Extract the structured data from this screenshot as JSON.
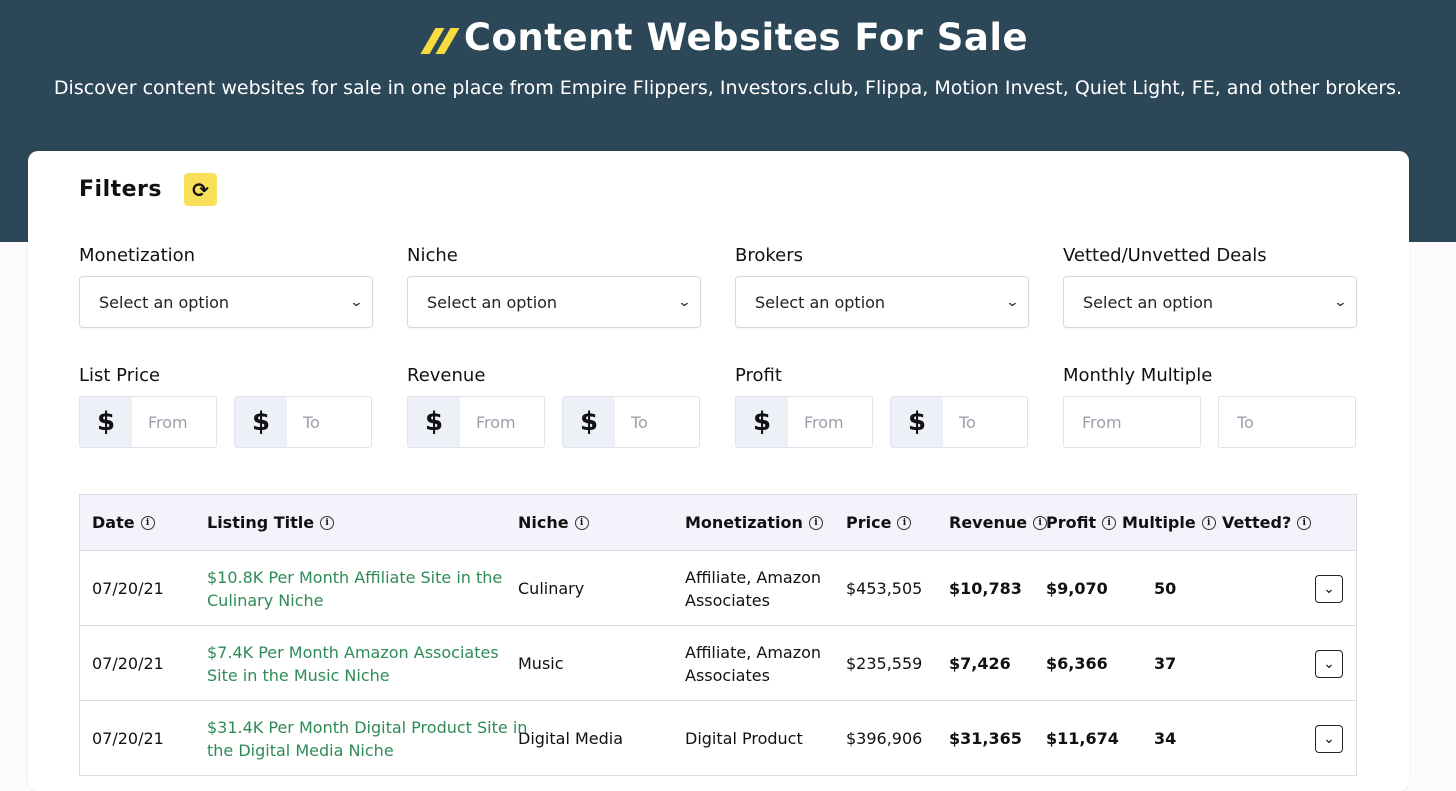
{
  "header": {
    "title": "Content Websites For Sale",
    "subtitle": "Discover content websites for sale in one place from Empire Flippers, Investors.club, Flippa, Motion Invest, Quiet Light, FE, and other brokers."
  },
  "filters": {
    "title": "Filters",
    "reset_icon": "refresh-icon",
    "selects": [
      {
        "label": "Monetization",
        "value": "Select an option"
      },
      {
        "label": "Niche",
        "value": "Select an option"
      },
      {
        "label": "Brokers",
        "value": "Select an option"
      },
      {
        "label": "Vetted/Unvetted Deals",
        "value": "Select an option"
      }
    ],
    "ranges": [
      {
        "label": "List Price",
        "currency": "$",
        "from": "From",
        "to": "To"
      },
      {
        "label": "Revenue",
        "currency": "$",
        "from": "From",
        "to": "To"
      },
      {
        "label": "Profit",
        "currency": "$",
        "from": "From",
        "to": "To"
      },
      {
        "label": "Monthly Multiple",
        "from": "From",
        "to": "To"
      }
    ]
  },
  "table": {
    "columns": [
      "Date",
      "Listing Title",
      "Niche",
      "Monetization",
      "Price",
      "Revenue",
      "Profit",
      "Multiple",
      "Vetted?"
    ],
    "rows": [
      {
        "date": "07/20/21",
        "title_1": "$10.8K Per Month Affiliate Site in the",
        "title_2": "Culinary Niche",
        "niche": "Culinary",
        "mon_1": "Affiliate, Amazon",
        "mon_2": "Associates",
        "price": "$453,505",
        "revenue": "$10,783",
        "profit": "$9,070",
        "multiple": "50"
      },
      {
        "date": "07/20/21",
        "title_1": "$7.4K Per Month Amazon Associates",
        "title_2": "Site in the Music Niche",
        "niche": "Music",
        "mon_1": "Affiliate, Amazon",
        "mon_2": "Associates",
        "price": "$235,559",
        "revenue": "$7,426",
        "profit": "$6,366",
        "multiple": "37"
      },
      {
        "date": "07/20/21",
        "title_1": "$31.4K Per Month Digital Product Site in",
        "title_2": "the Digital Media Niche",
        "niche": "Digital Media",
        "mon_1": "Digital Product",
        "mon_2": "",
        "price": "$396,906",
        "revenue": "$31,365",
        "profit": "$11,674",
        "multiple": "34"
      }
    ]
  },
  "colors": {
    "header_bg": "#2c4757",
    "accent_yellow": "#f9e05b",
    "link_green": "#2e8b57"
  }
}
